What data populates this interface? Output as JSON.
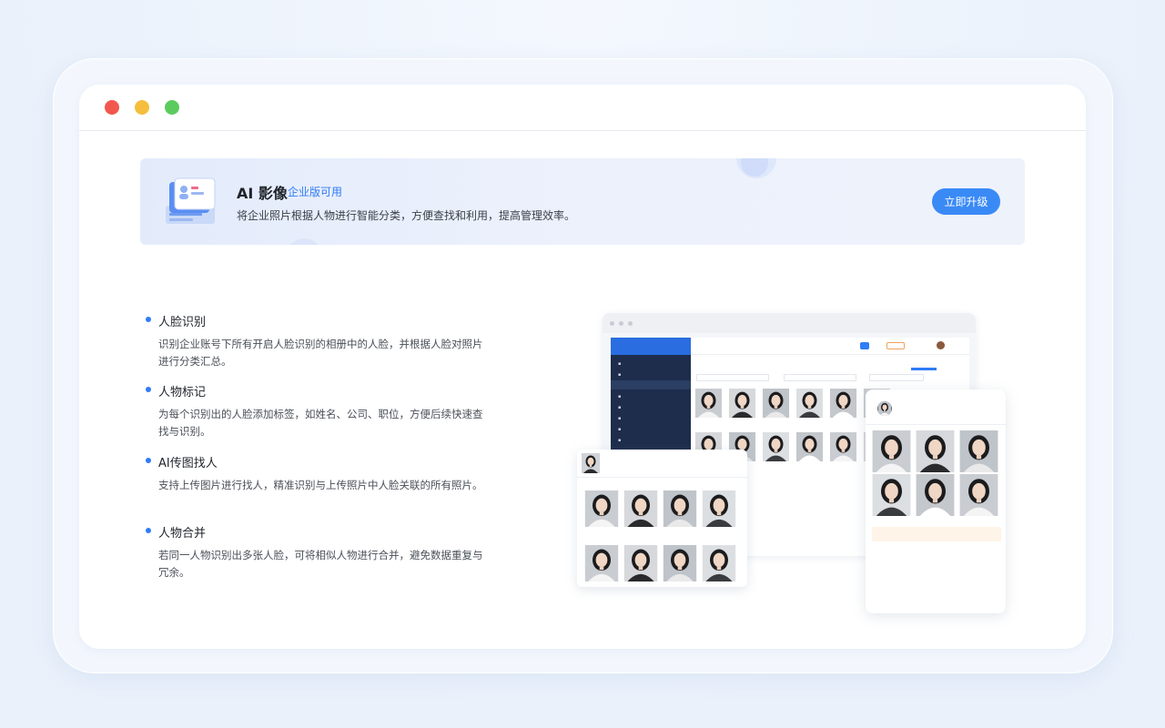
{
  "banner": {
    "title": "AI 影像",
    "tag": "企业版可用",
    "description": "将企业照片根据人物进行智能分类，方便查找和利用，提高管理效率。",
    "upgrade_label": "立即升级"
  },
  "features": [
    {
      "title": "人脸识别",
      "desc": "识别企业账号下所有开启人脸识别的相册中的人脸，并根据人脸对照片进行分类汇总。"
    },
    {
      "title": "人物标记",
      "desc": "为每个识别出的人脸添加标签，如姓名、公司、职位，方便后续快速查找与识别。"
    },
    {
      "title": "AI传图找人",
      "desc": "支持上传图片进行找人，精准识别与上传照片中人脸关联的所有照片。"
    },
    {
      "title": "人物合并",
      "desc": "若同一人物识别出多张人脸，可将相似人物进行合并，避免数据重复与冗余。"
    }
  ],
  "colors": {
    "accent": "#2f7cf6",
    "button": "#3a8af6",
    "sidebar": "#1e2d4c"
  }
}
